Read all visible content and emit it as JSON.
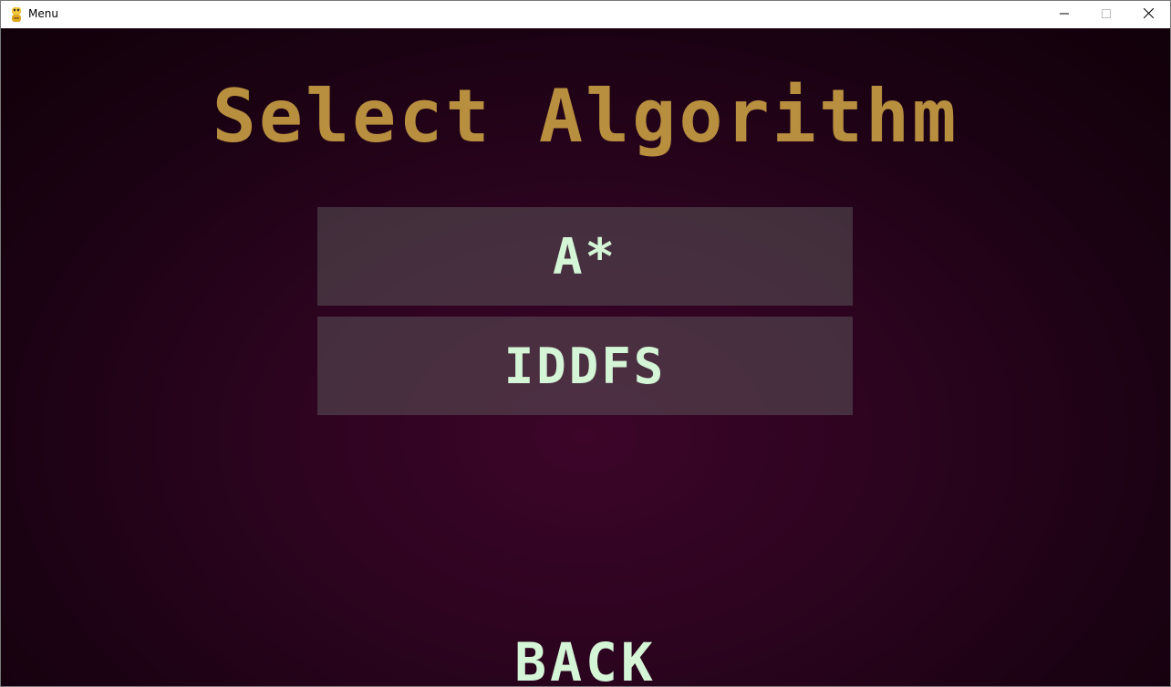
{
  "window": {
    "title": "Menu",
    "icon": "python-snake-icon"
  },
  "controls": {
    "minimize_icon": "minimize-icon",
    "maximize_icon": "maximize-icon",
    "close_icon": "close-icon"
  },
  "screen": {
    "heading": "Select Algorithm",
    "options": [
      {
        "label": "A*"
      },
      {
        "label": "IDDFS"
      }
    ],
    "back_label": "BACK"
  },
  "colors": {
    "heading": "#b88e3f",
    "button_text": "#d4f5d6",
    "background": "#2c041f"
  }
}
